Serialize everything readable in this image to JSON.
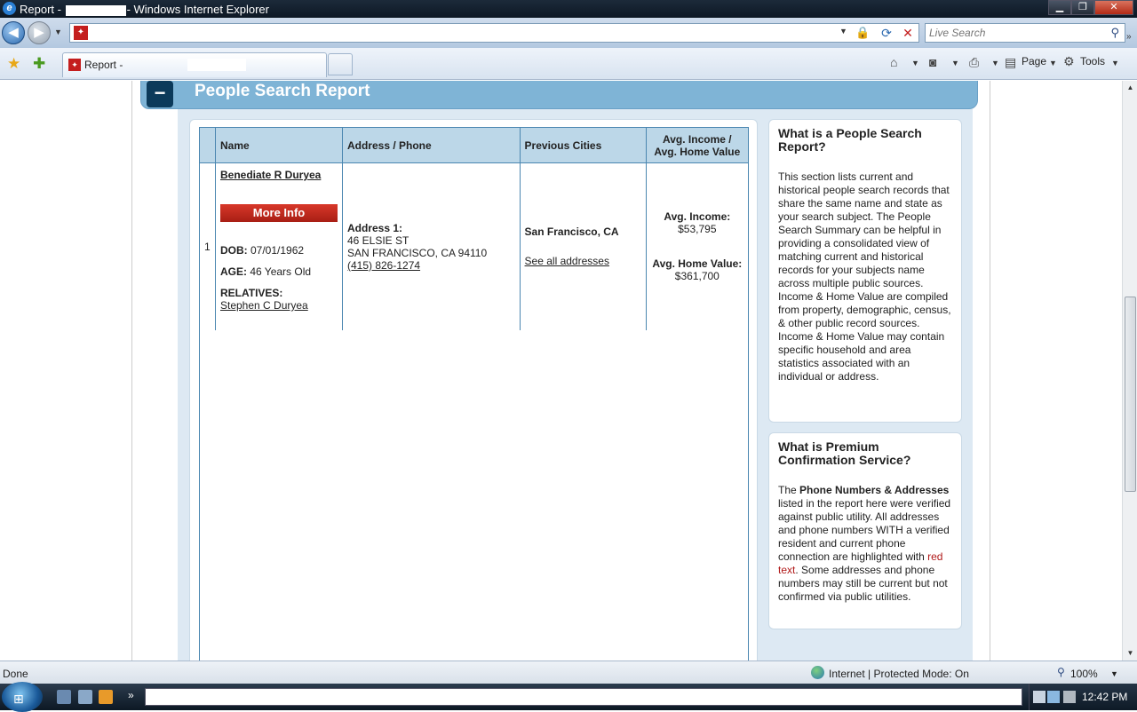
{
  "window": {
    "title_prefix": "Report - ",
    "title_suffix": "- Windows Internet Explorer"
  },
  "toolbar": {
    "search_placeholder": "Live Search",
    "tab_label": "Report -",
    "page_menu": "Page",
    "tools_menu": "Tools"
  },
  "report": {
    "title": "People Search Report",
    "collapse_symbol": "−",
    "columns": {
      "name": "Name",
      "address_phone": "Address / Phone",
      "previous_cities": "Previous Cities",
      "income_line1": "Avg. Income /",
      "income_line2": "Avg. Home Value"
    },
    "row": {
      "index": "1",
      "name": "Benediate R Duryea",
      "more_info": "More Info",
      "dob_label": "DOB:",
      "dob_value": "07/01/1962",
      "age_label": "AGE:",
      "age_value": "46 Years Old",
      "relatives_label": "RELATIVES:",
      "relative": "Stephen C Duryea",
      "address_label": "Address 1:",
      "address_line1": "46 ELSIE ST",
      "address_line2": "SAN FRANCISCO, CA 94110",
      "phone": "(415) 826-1274",
      "city": "San Francisco, CA",
      "see_all": "See all addresses",
      "income_label": "Avg. Income:",
      "income_value": "$53,795",
      "home_label": "Avg. Home Value:",
      "home_value": "$361,700"
    }
  },
  "sidebar": {
    "card1_title": "What is a People Search Report?",
    "card1_body": "This section lists current and historical people search records that share the same name and state as your search subject. The People Search Summary can be helpful in providing a consolidated view of matching current and historical records for your subjects name across multiple public sources. Income & Home Value are compiled from property, demographic, census, & other public record sources. Income & Home Value may contain specific household and area statistics associated with an individual or address.",
    "card2_title": "What is Premium Confirmation Service?",
    "card2_body_pre": "The ",
    "card2_body_bold": "Phone Numbers & Addresses",
    "card2_body_mid": " listed in the report here were verified against public utility. All addresses and phone numbers WITH a verified resident and current phone connection are highlighted with ",
    "card2_body_red": "red text",
    "card2_body_post": ". Some addresses and phone numbers may still be current but not confirmed via public utilities."
  },
  "status": {
    "left": "Done",
    "zone": "Internet | Protected Mode: On",
    "zoom": "100%"
  },
  "taskbar": {
    "clock": "12:42 PM"
  },
  "colors": {
    "header_blue": "#7fb4d6",
    "table_border": "#4a86b0",
    "more_info_red": "#c0281c",
    "highlight_red": "#b01818"
  }
}
